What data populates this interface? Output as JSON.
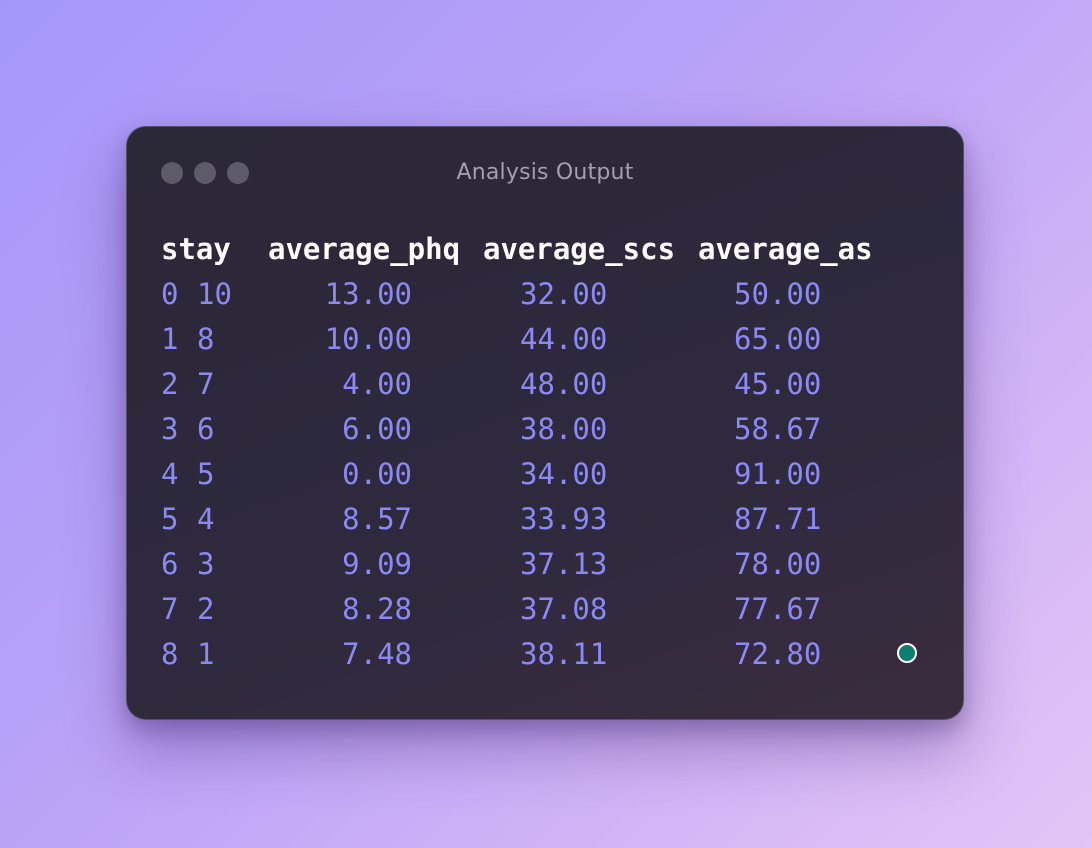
{
  "window": {
    "title": "Analysis Output",
    "status_color": "#0b7f70"
  },
  "table": {
    "header": {
      "stay": "stay",
      "phq": "average_phq",
      "scs": "average_scs",
      "as": "average_as"
    },
    "rows": [
      {
        "idx": "0",
        "stay": "10",
        "phq": "13.00",
        "scs": "32.00",
        "as": "50.00"
      },
      {
        "idx": "1",
        "stay": "8",
        "phq": "10.00",
        "scs": "44.00",
        "as": "65.00"
      },
      {
        "idx": "2",
        "stay": "7",
        "phq": "4.00",
        "scs": "48.00",
        "as": "45.00"
      },
      {
        "idx": "3",
        "stay": "6",
        "phq": "6.00",
        "scs": "38.00",
        "as": "58.67"
      },
      {
        "idx": "4",
        "stay": "5",
        "phq": "0.00",
        "scs": "34.00",
        "as": "91.00"
      },
      {
        "idx": "5",
        "stay": "4",
        "phq": "8.57",
        "scs": "33.93",
        "as": "87.71"
      },
      {
        "idx": "6",
        "stay": "3",
        "phq": "9.09",
        "scs": "37.13",
        "as": "78.00"
      },
      {
        "idx": "7",
        "stay": "2",
        "phq": "8.28",
        "scs": "37.08",
        "as": "77.67"
      },
      {
        "idx": "8",
        "stay": "1",
        "phq": "7.48",
        "scs": "38.11",
        "as": "72.80"
      }
    ]
  }
}
